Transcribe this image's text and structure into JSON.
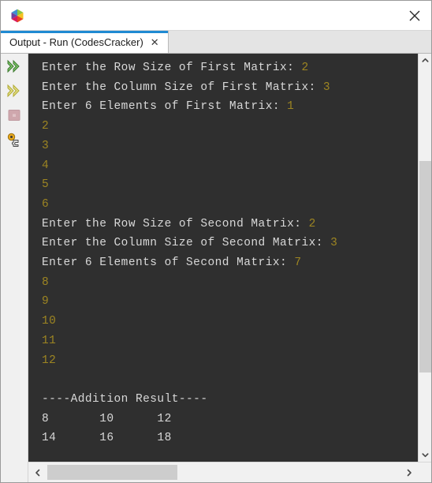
{
  "window": {
    "logo_icon": "netbeans-cube-icon",
    "close_icon": "close-icon",
    "close_label": "✕"
  },
  "tabstrip": {
    "tabs": [
      {
        "label": "Output - Run (CodesCracker)",
        "close_label": "✕",
        "active": true
      }
    ]
  },
  "toolbar": {
    "buttons": [
      {
        "name": "rerun-button",
        "icon": "double-chevron-right-green-icon",
        "color": "#4f9b3f"
      },
      {
        "name": "rerun-with-different-parameters-button",
        "icon": "double-chevron-right-yellow-icon",
        "color": "#b5ae2e"
      },
      {
        "name": "stop-button",
        "icon": "stop-square-icon",
        "color": "#c59ba1"
      },
      {
        "name": "settings-button",
        "icon": "gear-puzzle-icon",
        "color": "#d8a21b"
      }
    ]
  },
  "console": {
    "background": "#2f2f2f",
    "output_color": "#d8d8d8",
    "input_color": "#9d8522",
    "lines": [
      {
        "parts": [
          {
            "t": "Enter the Row Size of First Matrix: ",
            "k": "out"
          },
          {
            "t": "2",
            "k": "in"
          }
        ]
      },
      {
        "parts": [
          {
            "t": "Enter the Column Size of First Matrix: ",
            "k": "out"
          },
          {
            "t": "3",
            "k": "in"
          }
        ]
      },
      {
        "parts": [
          {
            "t": "Enter 6 Elements of First Matrix: ",
            "k": "out"
          },
          {
            "t": "1",
            "k": "in"
          }
        ]
      },
      {
        "parts": [
          {
            "t": "2",
            "k": "in"
          }
        ]
      },
      {
        "parts": [
          {
            "t": "3",
            "k": "in"
          }
        ]
      },
      {
        "parts": [
          {
            "t": "4",
            "k": "in"
          }
        ]
      },
      {
        "parts": [
          {
            "t": "5",
            "k": "in"
          }
        ]
      },
      {
        "parts": [
          {
            "t": "6",
            "k": "in"
          }
        ]
      },
      {
        "parts": [
          {
            "t": "Enter the Row Size of Second Matrix: ",
            "k": "out"
          },
          {
            "t": "2",
            "k": "in"
          }
        ]
      },
      {
        "parts": [
          {
            "t": "Enter the Column Size of Second Matrix: ",
            "k": "out"
          },
          {
            "t": "3",
            "k": "in"
          }
        ]
      },
      {
        "parts": [
          {
            "t": "Enter 6 Elements of Second Matrix: ",
            "k": "out"
          },
          {
            "t": "7",
            "k": "in"
          }
        ]
      },
      {
        "parts": [
          {
            "t": "8",
            "k": "in"
          }
        ]
      },
      {
        "parts": [
          {
            "t": "9",
            "k": "in"
          }
        ]
      },
      {
        "parts": [
          {
            "t": "10",
            "k": "in"
          }
        ]
      },
      {
        "parts": [
          {
            "t": "11",
            "k": "in"
          }
        ]
      },
      {
        "parts": [
          {
            "t": "12",
            "k": "in"
          }
        ]
      },
      {
        "parts": [
          {
            "t": "",
            "k": "out"
          }
        ]
      },
      {
        "parts": [
          {
            "t": "----Addition Result----",
            "k": "out"
          }
        ]
      },
      {
        "parts": [
          {
            "t": "8\t10\t12",
            "k": "out"
          }
        ]
      },
      {
        "parts": [
          {
            "t": "14\t16\t18",
            "k": "out"
          }
        ]
      }
    ]
  },
  "scrollbars": {
    "vertical": {
      "up_label": "⌃",
      "down_label": "⌄",
      "thumb_top_pct": 24.6,
      "thumb_height_pct": 55.5
    },
    "horizontal": {
      "left_label": "‹",
      "right_label": "›",
      "thumb_width_pct": 37
    }
  }
}
